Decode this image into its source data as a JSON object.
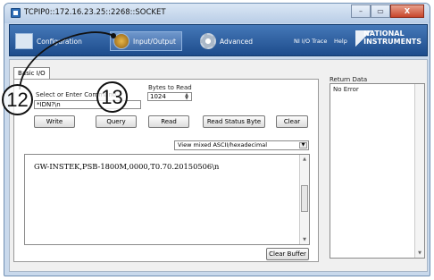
{
  "window": {
    "title": "TCPIP0::172.16.23.25::2268::SOCKET",
    "buttons": {
      "minimize": "–",
      "maximize": "▭",
      "close": "X"
    }
  },
  "toolbar": {
    "configuration": "Configuration",
    "input_output": "Input/Output",
    "advanced": "Advanced",
    "ni_io_trace": "NI I/O Trace",
    "help": "Help",
    "brand_line1": "NATIONAL",
    "brand_line2": "INSTRUMENTS"
  },
  "tab": {
    "label": "Basic I/O"
  },
  "command": {
    "label": "Select or Enter Command",
    "value": "*IDN?\\n"
  },
  "bytes": {
    "label": "Bytes to Read",
    "value": "1024"
  },
  "buttons": {
    "write": "Write",
    "query": "Query",
    "read": "Read",
    "read_status": "Read Status Byte",
    "clear": "Clear",
    "clear_buffer": "Clear Buffer"
  },
  "view_mode": {
    "selected": "View mixed ASCII/hexadecimal"
  },
  "output": {
    "text": "GW-INSTEK,PSB-1800M,0000,T0.70.20150506\\n"
  },
  "return_data": {
    "label": "Return Data",
    "value": "No Error"
  },
  "callouts": {
    "first": "12",
    "second": "13"
  }
}
